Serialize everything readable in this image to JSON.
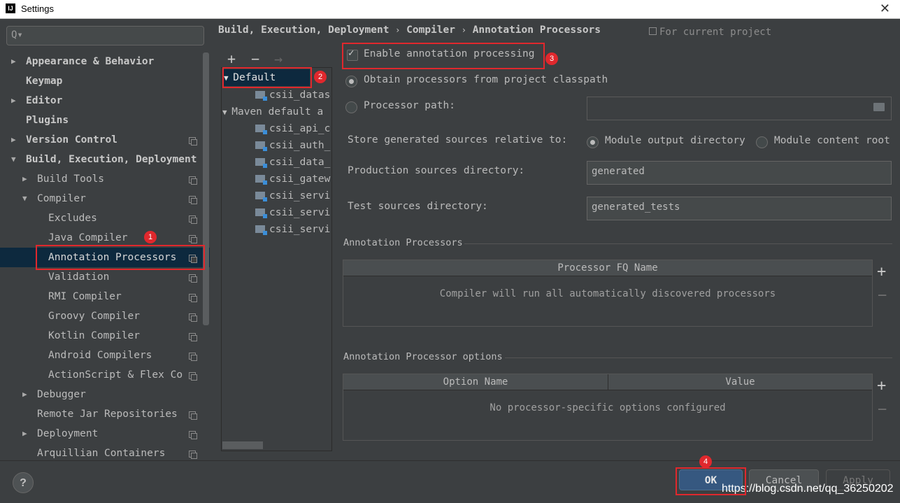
{
  "window": {
    "title": "Settings",
    "app_icon": "IJ",
    "close_glyph": "✕"
  },
  "search": {
    "icon": "search-icon",
    "glyph": "Q▾"
  },
  "sidebar": {
    "items": [
      {
        "label": "Appearance & Behavior"
      },
      {
        "label": "Keymap"
      },
      {
        "label": "Editor"
      },
      {
        "label": "Plugins"
      },
      {
        "label": "Version Control"
      },
      {
        "label": "Build, Execution, Deployment"
      },
      {
        "label": "Build Tools"
      },
      {
        "label": "Compiler"
      },
      {
        "label": "Excludes"
      },
      {
        "label": "Java Compiler"
      },
      {
        "label": "Annotation Processors"
      },
      {
        "label": "Validation"
      },
      {
        "label": "RMI Compiler"
      },
      {
        "label": "Groovy Compiler"
      },
      {
        "label": "Kotlin Compiler"
      },
      {
        "label": "Android Compilers"
      },
      {
        "label": "ActionScript & Flex Co"
      },
      {
        "label": "Debugger"
      },
      {
        "label": "Remote Jar Repositories"
      },
      {
        "label": "Deployment"
      },
      {
        "label": "Arquillian Containers"
      }
    ],
    "selected": "Annotation Processors"
  },
  "breadcrumb": {
    "parts": [
      "Build, Execution, Deployment",
      "Compiler",
      "Annotation Processors"
    ],
    "separator": "›",
    "scope": "For current project"
  },
  "profiles": {
    "toolbar": {
      "add": "+",
      "remove": "−",
      "move": "→"
    },
    "default_label": "Default",
    "default_children": [
      "csii_datas"
    ],
    "maven_label": "Maven default a",
    "maven_children": [
      "csii_api_c",
      "csii_auth_",
      "csii_data_",
      "csii_gatew",
      "csii_servi",
      "csii_servi",
      "csii_servi"
    ]
  },
  "settings": {
    "enable_label": "Enable annotation processing",
    "enable_checked": true,
    "obtain_label": "Obtain processors from project classpath",
    "processor_path_label": "Processor path:",
    "processor_path_value": "",
    "store_label": "Store generated sources relative to:",
    "module_output_label": "Module output directory",
    "module_content_label": "Module content root",
    "store_selected": "Module output directory",
    "prod_label": "Production sources directory:",
    "prod_value": "generated",
    "test_label": "Test sources directory:",
    "test_value": "generated_tests"
  },
  "processors_table": {
    "section_title": "Annotation Processors",
    "column": "Processor FQ Name",
    "empty_text": "Compiler will run all automatically discovered processors",
    "add": "+",
    "remove": "−"
  },
  "options_table": {
    "section_title": "Annotation Processor options",
    "columns": [
      "Option Name",
      "Value"
    ],
    "empty_text": "No processor-specific options configured",
    "add": "+",
    "remove": "−"
  },
  "footer": {
    "help": "?",
    "ok": "OK",
    "cancel": "Cancel",
    "apply": "Apply",
    "watermark": "https://blog.csdn.net/qq_36250202"
  },
  "annotations": {
    "badges": [
      "1",
      "2",
      "3",
      "4"
    ],
    "color": "#e0282d"
  },
  "colors": {
    "background": "#3c3f41",
    "selection": "#0d293e",
    "ok_button": "#365880"
  }
}
